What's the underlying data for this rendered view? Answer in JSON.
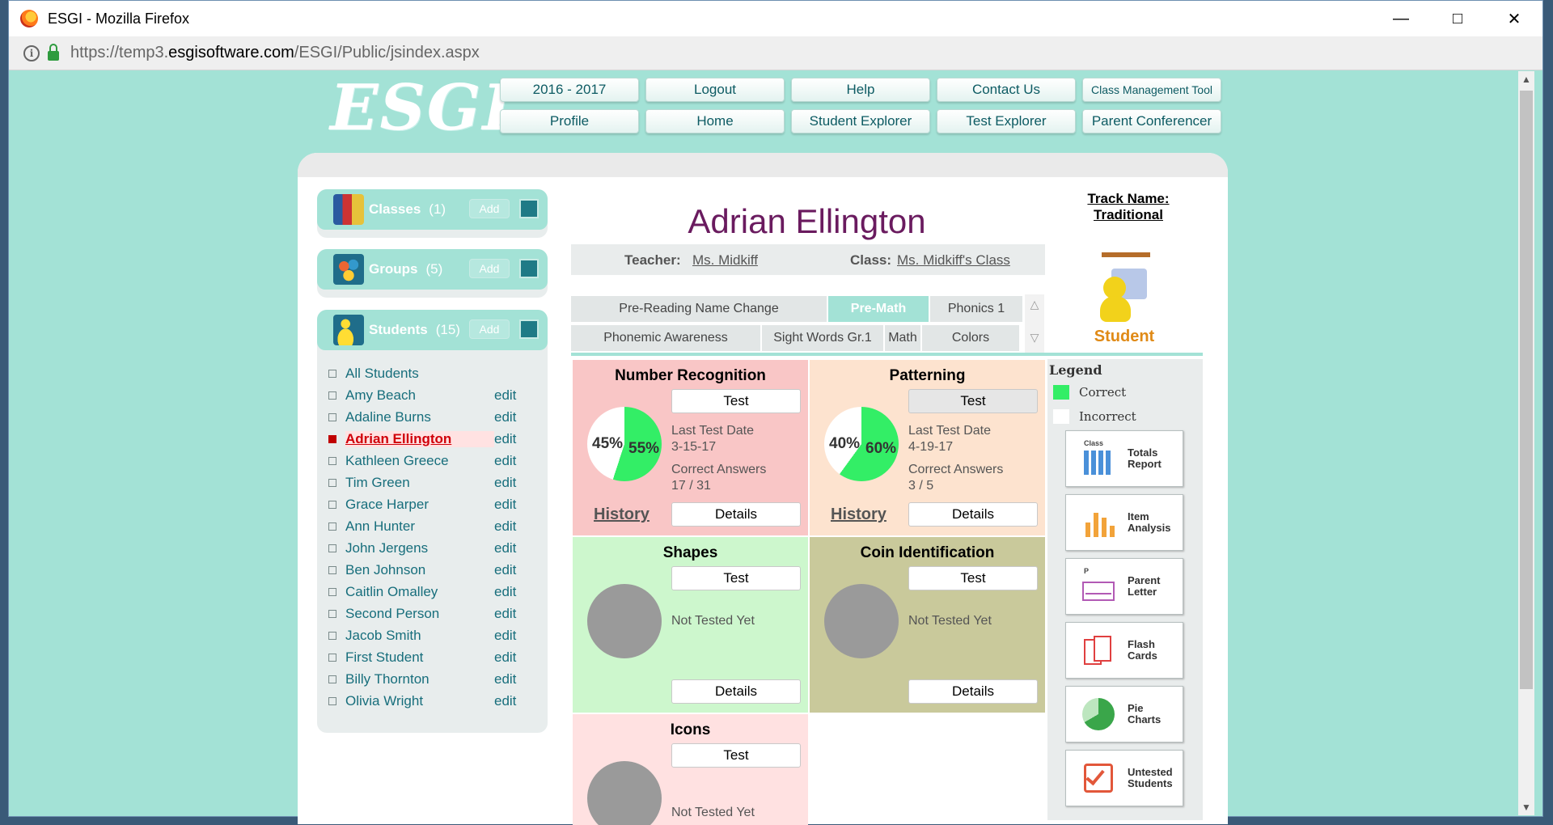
{
  "window": {
    "title": "ESGI - Mozilla Firefox",
    "url_prefix": "https://temp3.",
    "url_domain": "esgisoftware.com",
    "url_path": "/ESGI/Public/jsindex.aspx"
  },
  "header": {
    "logo": "ESGI",
    "nav_row1": [
      "2016 - 2017",
      "Logout",
      "Help",
      "Contact Us",
      "Class Management Tool"
    ],
    "nav_row2": [
      "Profile",
      "Home",
      "Student Explorer",
      "Test Explorer",
      "Parent Conferencer"
    ]
  },
  "sidebar": {
    "classes": {
      "label": "Classes",
      "count": "(1)",
      "add": "Add"
    },
    "groups": {
      "label": "Groups",
      "count": "(5)",
      "add": "Add"
    },
    "students": {
      "label": "Students",
      "count": "(15)",
      "add": "Add"
    },
    "all_students": "All Students",
    "edit_label": "edit",
    "student_list": [
      "Amy Beach",
      "Adaline Burns",
      "Adrian Ellington",
      "Kathleen Greece",
      "Tim Green",
      "Grace Harper",
      "Ann Hunter",
      "John Jergens",
      "Ben Johnson",
      "Caitlin Omalley",
      "Second Person",
      "Jacob Smith",
      "First Student",
      "Billy Thornton",
      "Olivia Wright"
    ],
    "selected_student": "Adrian Ellington"
  },
  "student": {
    "name": "Adrian Ellington",
    "teacher_label": "Teacher:",
    "teacher": "Ms. Midkiff",
    "class_label": "Class:",
    "class": "Ms. Midkiff's Class",
    "track_line1": "Track Name:",
    "track_line2": "Traditional",
    "role": "Student"
  },
  "tabs": {
    "row1": [
      "Pre-Reading Name Change",
      "Pre-Math",
      "Phonics 1"
    ],
    "row2": [
      "Phonemic Awareness",
      "Sight Words Gr.1",
      "Math",
      "Colors"
    ],
    "active": "Pre-Math"
  },
  "cards": [
    {
      "title": "Number Recognition",
      "test": "Test",
      "last_date_label": "Last Test Date",
      "last_date": "3-15-17",
      "correct_label": "Correct Answers",
      "correct": "17 / 31",
      "history": "History",
      "details": "Details",
      "pct_incorrect": "45%",
      "pct_correct": "55%",
      "correct_fraction": 0.55
    },
    {
      "title": "Patterning",
      "test": "Test",
      "last_date_label": "Last Test Date",
      "last_date": "4-19-17",
      "correct_label": "Correct Answers",
      "correct": "3 / 5",
      "history": "History",
      "details": "Details",
      "pct_incorrect": "40%",
      "pct_correct": "60%",
      "correct_fraction": 0.6
    },
    {
      "title": "Shapes",
      "test": "Test",
      "status": "Not Tested Yet",
      "details": "Details"
    },
    {
      "title": "Coin Identification",
      "test": "Test",
      "status": "Not Tested Yet",
      "details": "Details"
    },
    {
      "title": "Icons",
      "test": "Test",
      "status": "Not Tested Yet"
    }
  ],
  "legend": {
    "title": "Legend",
    "correct": "Correct",
    "incorrect": "Incorrect",
    "correct_color": "#33ee66",
    "incorrect_color": "#ffffff"
  },
  "tools": [
    {
      "small": "Class",
      "line1": "Totals",
      "line2": "Report"
    },
    {
      "small": "",
      "line1": "Item",
      "line2": "Analysis"
    },
    {
      "small": "P",
      "line1": "Parent",
      "line2": "Letter"
    },
    {
      "small": "",
      "line1": "Flash",
      "line2": "Cards"
    },
    {
      "small": "",
      "line1": "Pie",
      "line2": "Charts"
    },
    {
      "small": "",
      "line1": "Untested",
      "line2": "Students"
    }
  ],
  "colors": {
    "page_bg": "#a3e2d6",
    "accent_purple": "#6a1b5f",
    "nav_text": "#0d5b63",
    "card_red": "#f9c6c6",
    "card_peach": "#fde3cf",
    "card_green": "#cdf7cd",
    "card_olive": "#c9c99b",
    "card_pink": "#ffe1e1"
  }
}
